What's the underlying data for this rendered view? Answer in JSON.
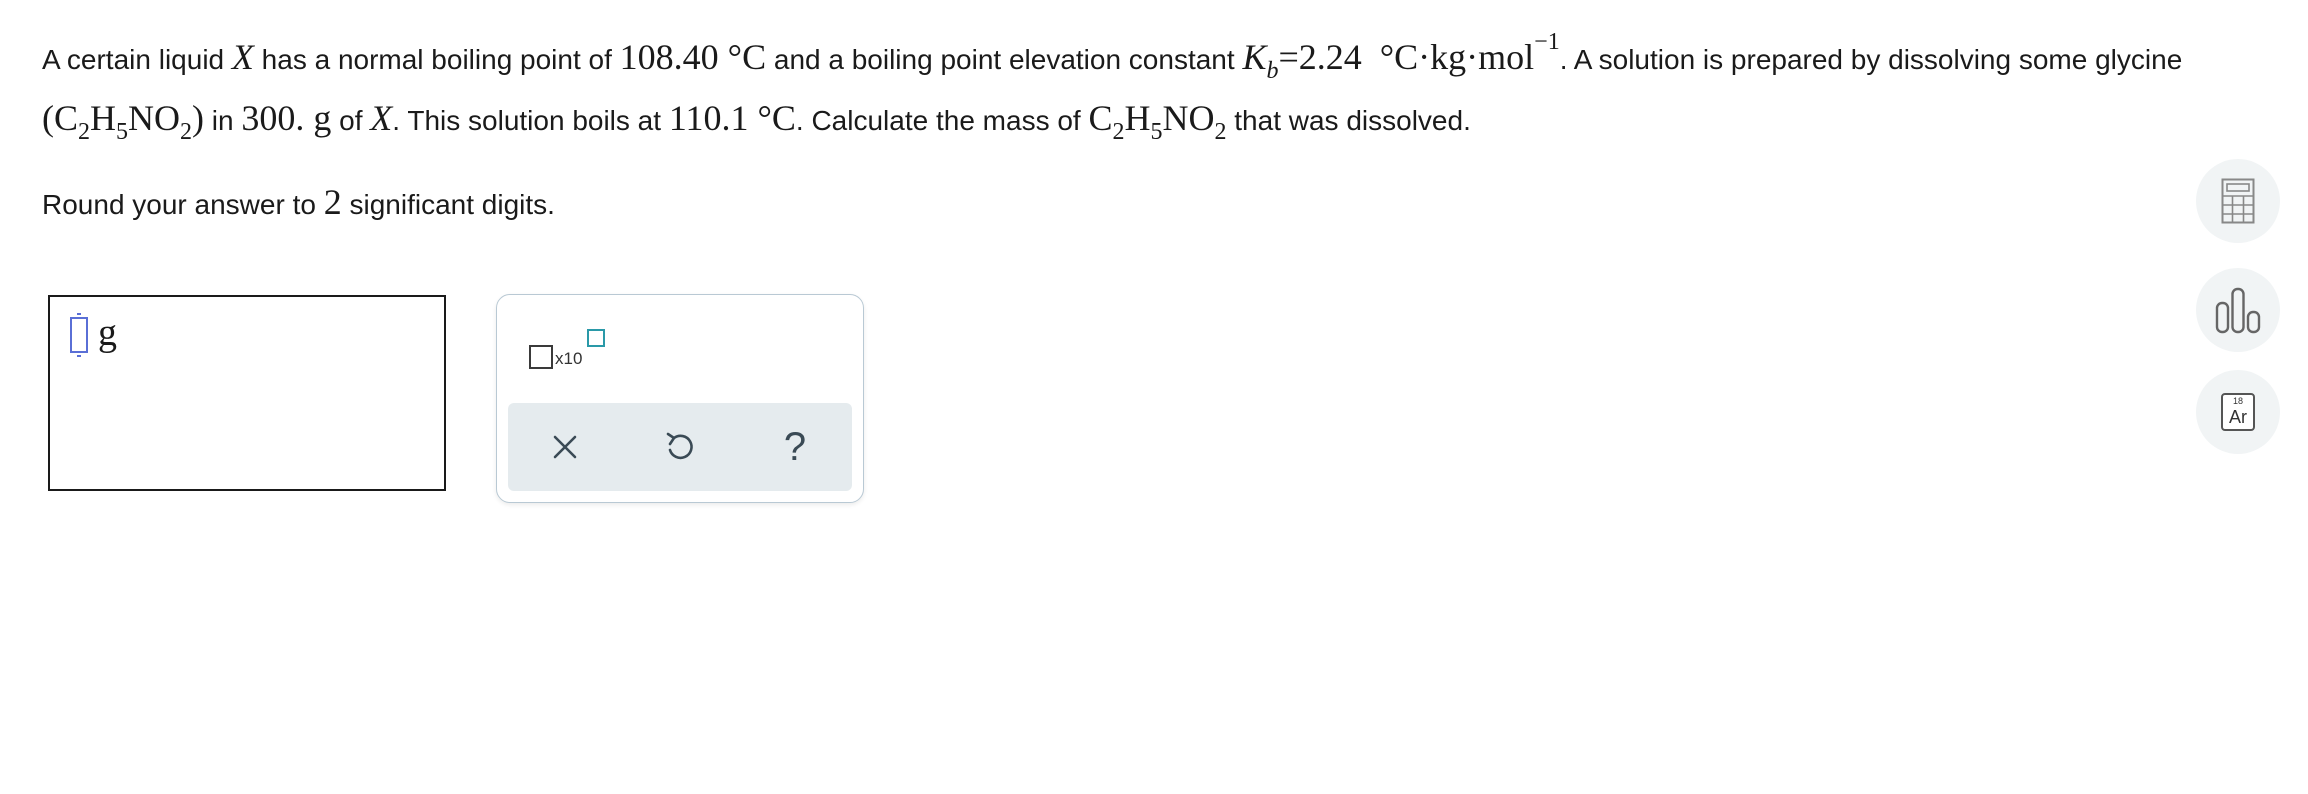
{
  "problem": {
    "t1": "A certain liquid ",
    "var_x": "X",
    "t2": " has a normal boiling point of ",
    "bp": "108.40",
    "deg_c": " °C",
    "t3": " and a boiling point elevation constant ",
    "kb_k": "K",
    "kb_sub": "b",
    "kb_value": "=2.24",
    "kb_units": "°C·kg·mol",
    "kb_exp": "−1",
    "t4": ". A solution is prepared by dissolving some glycine ",
    "open_paren": "(",
    "el_c": "C",
    "n2": "2",
    "el_h": "H",
    "n5": "5",
    "el_no": "NO",
    "close_paren": ")",
    "t5": " in ",
    "mass": "300.",
    "unit_g": " g",
    "t6": " of ",
    "var_x2": "X",
    "period": ".",
    "t7": " This solution boils at ",
    "solution_bp": "110.1",
    "deg_c2": " °C",
    "t8": ". Calculate the mass of ",
    "t9": " that was dissolved."
  },
  "instruction": {
    "t1": "Round your answer to ",
    "digits": "2",
    "t2": " significant digits."
  },
  "answer": {
    "value": "",
    "unit": "g"
  },
  "keypad": {
    "sci_label": "x10",
    "clear_icon": "close-icon",
    "undo_icon": "undo-icon",
    "help_label": "?"
  },
  "tools": {
    "calculator_icon": "calculator-icon",
    "chart_icon": "bar-chart-icon",
    "periodic_table": {
      "number": "18",
      "symbol": "Ar"
    }
  }
}
